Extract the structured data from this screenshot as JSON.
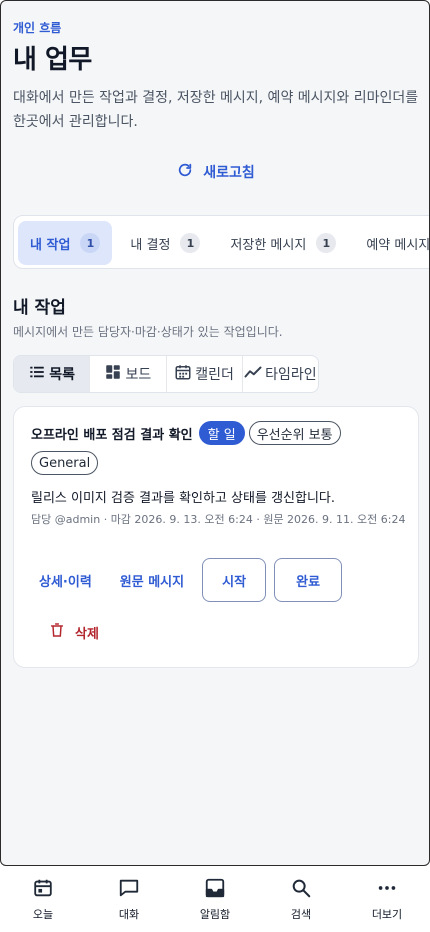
{
  "header": {
    "eyebrow": "개인 흐름",
    "title": "내 업무",
    "description": "대화에서 만든 작업과 결정, 저장한 메시지, 예약 메시지와 리마인더를 한곳에서 관리합니다.",
    "refresh_label": "새로고침"
  },
  "tabs": [
    {
      "label": "내 작업",
      "count": "1",
      "active": true
    },
    {
      "label": "내 결정",
      "count": "1"
    },
    {
      "label": "저장한 메시지",
      "count": "1"
    },
    {
      "label": "예약 메시지",
      "count": ""
    }
  ],
  "section": {
    "title": "내 작업",
    "description": "메시지에서 만든 담당자·마감·상태가 있는 작업입니다."
  },
  "views": [
    {
      "label": "목록",
      "icon": "list-icon",
      "active": true
    },
    {
      "label": "보드",
      "icon": "board-icon"
    },
    {
      "label": "캘린더",
      "icon": "calendar-icon"
    },
    {
      "label": "타임라인",
      "icon": "timeline-icon"
    }
  ],
  "task": {
    "title": "오프라인 배포 점검 결과 확인",
    "status": "할 일",
    "priority": "우선순위 보통",
    "channel": "General",
    "description": "릴리스 이미지 검증 결과를 확인하고 상태를 갱신합니다.",
    "meta": "담당 @admin · 마감 2026. 9. 13. 오전 6:24 · 원문 2026. 9. 11. 오전 6:24",
    "actions": {
      "history": "상세·이력",
      "source": "원문 메시지",
      "start": "시작",
      "complete": "완료",
      "delete": "삭제"
    }
  },
  "colors": {
    "accent": "#2f5bd3",
    "danger": "#b3262e",
    "page_bg": "#f5f6f8"
  },
  "bottom_nav": [
    {
      "label": "오늘",
      "icon": "calendar-icon"
    },
    {
      "label": "대화",
      "icon": "chat-icon"
    },
    {
      "label": "알림함",
      "icon": "inbox-icon"
    },
    {
      "label": "검색",
      "icon": "search-icon"
    },
    {
      "label": "더보기",
      "icon": "more-icon"
    }
  ]
}
